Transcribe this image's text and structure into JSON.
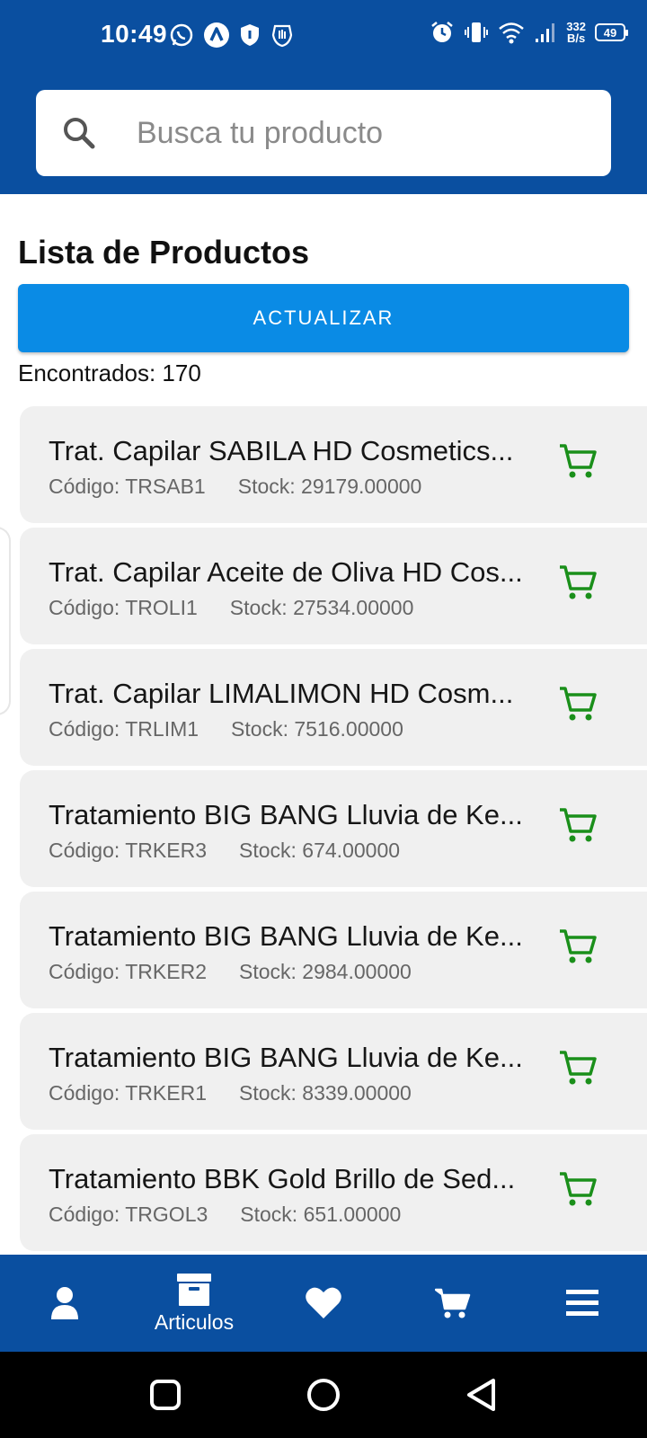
{
  "status_bar": {
    "time": "10:49",
    "net_speed_value": "332",
    "net_speed_unit": "B/s",
    "battery": "49"
  },
  "search": {
    "placeholder": "Busca tu producto",
    "value": ""
  },
  "page": {
    "title": "Lista de Productos",
    "refresh_label": "ACTUALIZAR",
    "found_text": "Encontrados: 170"
  },
  "products": [
    {
      "name": "Trat. Capilar SABILA HD Cosmetics...",
      "code": "Código: TRSAB1",
      "stock": "Stock: 29179.00000"
    },
    {
      "name": "Trat. Capilar Aceite de Oliva HD Cos...",
      "code": "Código: TROLI1",
      "stock": "Stock: 27534.00000"
    },
    {
      "name": "Trat. Capilar LIMALIMON HD Cosm...",
      "code": "Código: TRLIM1",
      "stock": "Stock: 7516.00000"
    },
    {
      "name": "Tratamiento BIG BANG Lluvia de Ke...",
      "code": "Código: TRKER3",
      "stock": "Stock: 674.00000"
    },
    {
      "name": "Tratamiento BIG BANG Lluvia de Ke...",
      "code": "Código: TRKER2",
      "stock": "Stock: 2984.00000"
    },
    {
      "name": "Tratamiento BIG BANG Lluvia de Ke...",
      "code": "Código: TRKER1",
      "stock": "Stock: 8339.00000"
    },
    {
      "name": "Tratamiento BBK  Gold Brillo de Sed...",
      "code": "Código: TRGOL3",
      "stock": "Stock: 651.00000"
    }
  ],
  "bottom_nav": {
    "items": [
      {
        "icon": "person-icon",
        "label": ""
      },
      {
        "icon": "archive-box-icon",
        "label": "Articulos",
        "active": true
      },
      {
        "icon": "heart-icon",
        "label": ""
      },
      {
        "icon": "cart-icon",
        "label": ""
      },
      {
        "icon": "menu-icon",
        "label": ""
      }
    ]
  },
  "colors": {
    "header_blue": "#0a4fa0",
    "button_blue": "#0a8be5",
    "cart_green": "#1a8f1a",
    "card_bg": "#f0f0f0"
  }
}
